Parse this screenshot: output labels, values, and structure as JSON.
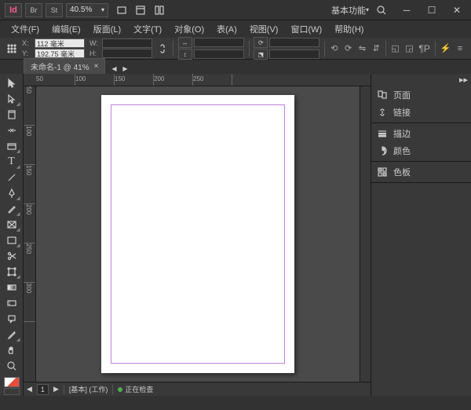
{
  "app": {
    "logo": "Id",
    "br": "Br",
    "st": "St",
    "zoom": "40.5%",
    "workspace": "基本功能"
  },
  "menu": [
    "文件(F)",
    "编辑(E)",
    "版面(L)",
    "文字(T)",
    "对象(O)",
    "表(A)",
    "视图(V)",
    "窗口(W)",
    "帮助(H)"
  ],
  "control": {
    "x_label": "X:",
    "x_value": "112 毫米",
    "y_label": "Y:",
    "y_value": "192.75 毫米",
    "w_label": "W:",
    "w_value": "",
    "h_label": "H:",
    "h_value": ""
  },
  "tabs": [
    {
      "label": "未命名-1 @ 41%"
    }
  ],
  "ruler_h": [
    "50",
    "100",
    "150",
    "200",
    "250"
  ],
  "ruler_v": [
    "50",
    "100",
    "150",
    "200",
    "250",
    "300"
  ],
  "footer": {
    "page_nav": "1",
    "layout": "[基本] (工作)",
    "status": "正在检查"
  },
  "panels": {
    "group1": [
      {
        "icon": "pages",
        "label": "页面"
      },
      {
        "icon": "links",
        "label": "链接"
      }
    ],
    "group2": [
      {
        "icon": "stroke",
        "label": "描边"
      },
      {
        "icon": "color",
        "label": "颜色"
      }
    ],
    "group3": [
      {
        "icon": "swatches",
        "label": "色板"
      }
    ]
  }
}
